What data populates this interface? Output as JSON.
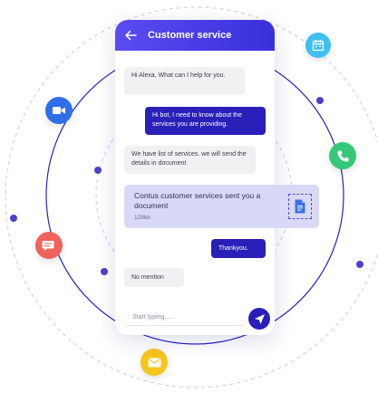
{
  "header": {
    "title": "Customer service"
  },
  "messages": [
    {
      "from": "bot",
      "text": "Hi Alexa, What can I help for you."
    },
    {
      "from": "user",
      "text": "Hi bot, I need to know about the services you are providing."
    },
    {
      "from": "bot",
      "text": "We have list of services. we will send the details in document"
    },
    {
      "from": "user",
      "text": "Thankyou."
    },
    {
      "from": "bot",
      "text": "No mention"
    }
  ],
  "document": {
    "title": "Contus customer services sent you a document",
    "size": "129kb"
  },
  "composer": {
    "placeholder": "Start typing......"
  },
  "colors": {
    "accent": "#2a1fb8",
    "header_gradient": [
      "#5b4cf0",
      "#3a2fdc"
    ],
    "video": "#2f6ee8",
    "chat": "#f0625c",
    "calendar": "#3ec1f2",
    "phone": "#36c879",
    "mail": "#f7c51b"
  },
  "floating_icons": [
    "calendar-icon",
    "video-icon",
    "phone-call-icon",
    "chat-bubble-icon",
    "mail-icon"
  ]
}
